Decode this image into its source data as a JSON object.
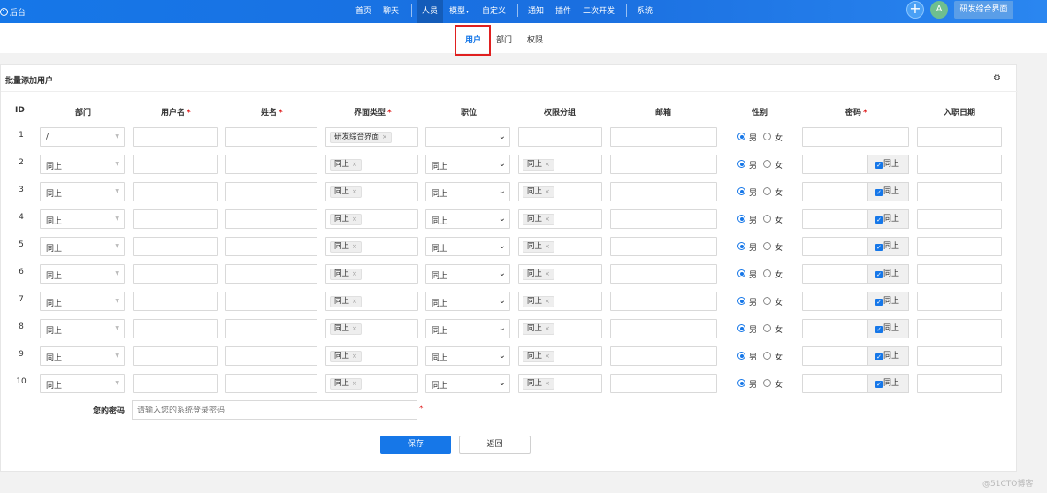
{
  "topbar": {
    "logo": "后台",
    "nav": [
      "首页",
      "聊天",
      "人员",
      "模型",
      "自定义",
      "通知",
      "插件",
      "二次开发",
      "系统"
    ],
    "active_nav": "人员",
    "avatar_letter": "A",
    "profile_label": "研发综合界面",
    "plus": "+"
  },
  "subtabs": [
    "用户",
    "部门",
    "权限"
  ],
  "active_subtab": "用户",
  "panel": {
    "title": "批量添加用户",
    "columns": [
      "ID",
      "部门",
      "用户名",
      "姓名",
      "界面类型",
      "职位",
      "权限分组",
      "邮箱",
      "性别",
      "密码",
      "入职日期"
    ],
    "required_mark": "*",
    "same_label": "同上",
    "first_row": {
      "dept": "/",
      "ui_type": "研发综合界面"
    },
    "tag_close": "×",
    "gender": {
      "male": "男",
      "female": "女"
    },
    "row_ids": [
      "1",
      "2",
      "3",
      "4",
      "5",
      "6",
      "7",
      "8",
      "9",
      "10"
    ]
  },
  "password": {
    "label": "您的密码",
    "placeholder": "请输入您的系统登录密码",
    "required_mark": "*"
  },
  "buttons": {
    "save": "保存",
    "back": "返回"
  },
  "watermark": "@51CTO博客"
}
